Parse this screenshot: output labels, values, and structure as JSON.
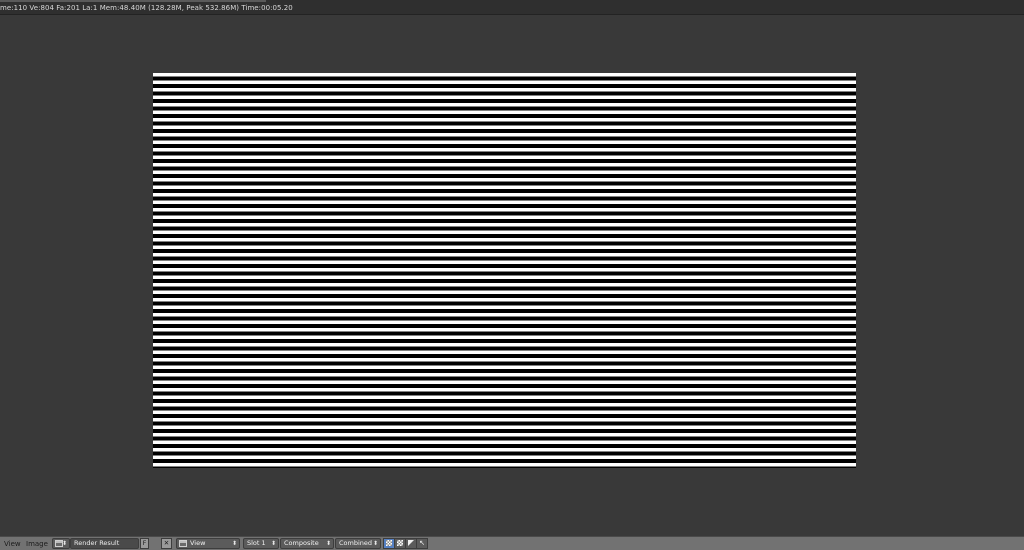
{
  "status_bar": {
    "text": "me:110 Ve:804 Fa:201 La:1 Mem:48.40M (128.28M, Peak 532.86M) Time:00:05.20"
  },
  "viewport": {
    "image_description_label": "Render Result"
  },
  "header": {
    "menus": {
      "view": "View",
      "image": "Image"
    },
    "image_name": "Render Result",
    "fake_user_label": "F",
    "close_label": "✕",
    "view_label": "View",
    "slot_label": "Slot 1",
    "composite_label": "Composite",
    "pass_label": "Combined",
    "icons": {
      "image_browse": "image-icon",
      "view_display": "image-icon",
      "alpha_toggle": "checkerboard-icon",
      "channel_toggle": "triangle-icon",
      "cursor_tool": "cursor-icon"
    }
  },
  "colors": {
    "background": "#393939",
    "header": "#727272",
    "active_toggle": "#5680c2"
  }
}
